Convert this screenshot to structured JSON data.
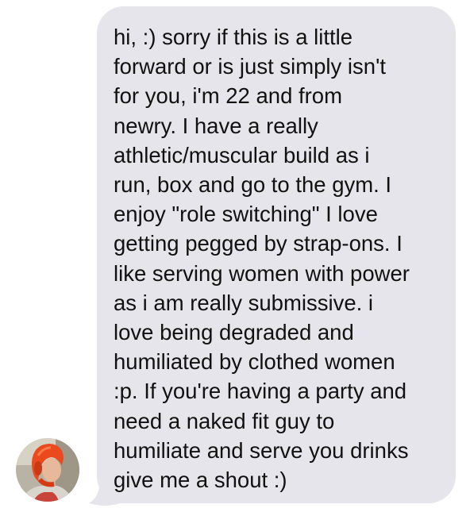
{
  "conversation": {
    "contact": {
      "avatar_icon": "contact-avatar-photo"
    },
    "message": {
      "text": "hi, :) sorry if this is a little\nforward or is just simply isn't\nfor you, i'm 22 and from\nnewry. I have a really\nathletic/muscular build as i\nrun, box and go to the gym. I\nenjoy \"role switching\" I love\ngetting pegged by strap-ons. I\nlike serving women with power\nas i am really submissive. i\nlove being degraded and\nhumiliated by clothed women\n:p. If you're having a party and\nneed a naked fit guy to\nhumiliate and serve you drinks\ngive me a shout :)",
      "direction": "incoming"
    }
  },
  "colors": {
    "bubble": "#e6e5eb",
    "text": "#111111",
    "background": "#ffffff"
  }
}
